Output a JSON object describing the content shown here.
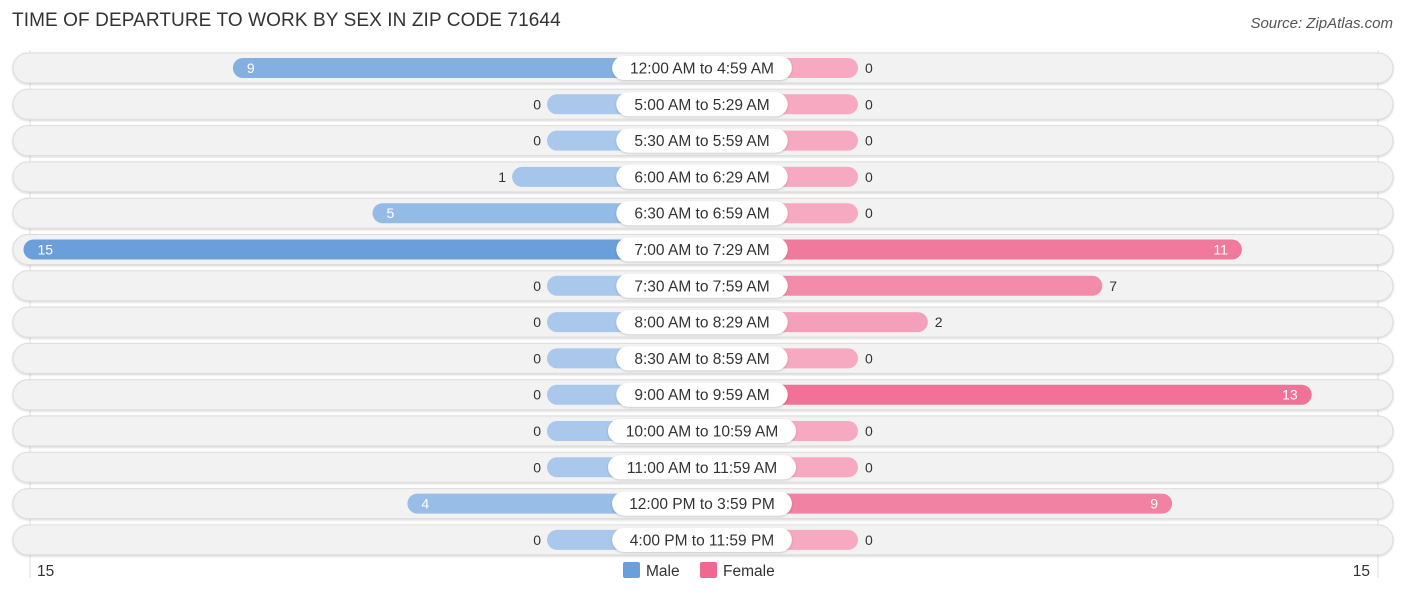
{
  "title": "TIME OF DEPARTURE TO WORK BY SEX IN ZIP CODE 71644",
  "source": "Source: ZipAtlas.com",
  "colors": {
    "male": "#6a9fdb",
    "male_light": "#a9c8eb",
    "female": "#f06892",
    "female_light": "#f6a9c0",
    "row_bg": "#f2f2f2"
  },
  "legend": [
    {
      "label": "Male",
      "color": "#6a9fdb"
    },
    {
      "label": "Female",
      "color": "#f06892"
    }
  ],
  "axis": {
    "left_label": "15",
    "right_label": "15"
  },
  "chart_data": {
    "type": "bar",
    "orientation": "horizontal-diverging",
    "title": "TIME OF DEPARTURE TO WORK BY SEX IN ZIP CODE 71644",
    "categories": [
      "12:00 AM to 4:59 AM",
      "5:00 AM to 5:29 AM",
      "5:30 AM to 5:59 AM",
      "6:00 AM to 6:29 AM",
      "6:30 AM to 6:59 AM",
      "7:00 AM to 7:29 AM",
      "7:30 AM to 7:59 AM",
      "8:00 AM to 8:29 AM",
      "8:30 AM to 8:59 AM",
      "9:00 AM to 9:59 AM",
      "10:00 AM to 10:59 AM",
      "11:00 AM to 11:59 AM",
      "12:00 PM to 3:59 PM",
      "4:00 PM to 11:59 PM"
    ],
    "series": [
      {
        "name": "Male",
        "values": [
          9,
          0,
          0,
          1,
          5,
          15,
          0,
          0,
          0,
          0,
          0,
          0,
          4,
          0
        ]
      },
      {
        "name": "Female",
        "values": [
          0,
          0,
          0,
          0,
          0,
          11,
          7,
          2,
          0,
          13,
          0,
          0,
          9,
          0
        ]
      }
    ],
    "xlim": [
      -15,
      15
    ],
    "legend_position": "bottom-center"
  }
}
